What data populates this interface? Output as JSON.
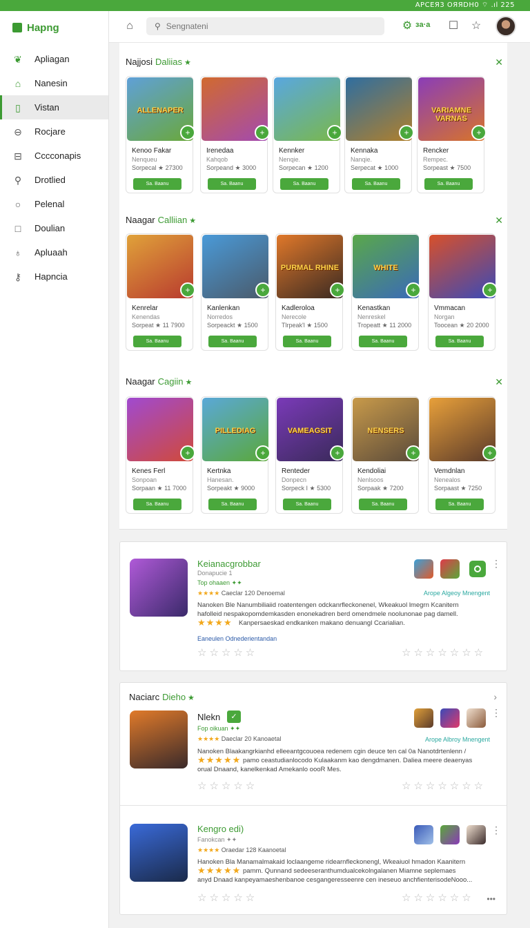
{
  "status_bar": {
    "text": "APCEЯ3  OЯЯDH0  ⌔ .ıl  225"
  },
  "sidebar": {
    "brand": "Hapng",
    "items": [
      {
        "label": "Apliagan",
        "icon": "leaf-icon"
      },
      {
        "label": "Nanesin",
        "icon": "home-icon"
      },
      {
        "label": "Vistan",
        "icon": "panel-icon",
        "active": true
      },
      {
        "label": "Rocjare",
        "icon": "globe-icon"
      },
      {
        "label": "Cccconapis",
        "icon": "grid-icon"
      },
      {
        "label": "Drotlied",
        "icon": "search-icon"
      },
      {
        "label": "Pelenal",
        "icon": "circle-icon"
      },
      {
        "label": "Doulian",
        "icon": "square-icon"
      },
      {
        "label": "Apluaah",
        "icon": "person-icon"
      },
      {
        "label": "Hapncia",
        "icon": "key-icon"
      }
    ]
  },
  "header": {
    "search_placeholder": "Sengnateni",
    "status": "ɜa·a"
  },
  "sections": [
    {
      "title": "Najjosi",
      "accent": "Daliias",
      "cards": [
        {
          "art_text": "ALLENAPER",
          "name": "Kenoo Fakar",
          "sub": "Nenqueu",
          "meta": "Sorpecal ★ 27300",
          "btn": "Sa. Baanu",
          "colors": [
            "#5fa0d8",
            "#6aa83a"
          ]
        },
        {
          "art_text": "",
          "name": "Irenedaa",
          "sub": "Kahqob",
          "meta": "Sorpeand ★ 3000",
          "btn": "Sa. Baanu",
          "colors": [
            "#d16a2e",
            "#a34ab0"
          ]
        },
        {
          "art_text": "",
          "name": "Kennker",
          "sub": "Nenqie.",
          "meta": "Sorpecan ★ 1200",
          "btn": "Sa. Baanu",
          "colors": [
            "#59a7e0",
            "#7ab84a"
          ]
        },
        {
          "art_text": "",
          "name": "Kennaka",
          "sub": "Nanqie.",
          "meta": "Serpecat ★ 1000",
          "btn": "Sa. Baanu",
          "colors": [
            "#2f6ea0",
            "#b0802c"
          ]
        },
        {
          "art_text": "VARIAMNE VARNAS",
          "name": "Rencker",
          "sub": "Rempec.",
          "meta": "Sorpeast ★ 7500",
          "btn": "Sa. Baanu",
          "colors": [
            "#8a3db8",
            "#d8742a"
          ]
        }
      ]
    },
    {
      "title": "Naagar",
      "accent": "Calliian",
      "cards": [
        {
          "art_text": "",
          "name": "Kenrelar",
          "sub": "Kenendas",
          "meta": "Sorpeat ★ 11 7900",
          "btn": "Sa. Baanu",
          "colors": [
            "#e0a23a",
            "#b83a2e"
          ]
        },
        {
          "art_text": "",
          "name": "Kanlenkan",
          "sub": "Norredos",
          "meta": "Sorpeackt ★ 1500",
          "btn": "Sa. Baanu",
          "colors": [
            "#4a9ad8",
            "#4a5a6a"
          ]
        },
        {
          "art_text": "PURMAL RHINE",
          "name": "Kadleroloa",
          "sub": "Nerecole",
          "meta": "Tlrpeak'l ★ 1500",
          "btn": "Sa. Baanu",
          "colors": [
            "#e0782a",
            "#3a2a22"
          ]
        },
        {
          "art_text": "WHITE",
          "name": "Kenastkan",
          "sub": "Nenreskel",
          "meta": "Tropeatt ★ 11 2000",
          "btn": "Sa. Baanu",
          "colors": [
            "#5aa84a",
            "#3a6ab8"
          ]
        },
        {
          "art_text": "",
          "name": "Vmmacan",
          "sub": "Norgan",
          "meta": "Toocean ★ 20 2000",
          "btn": "Sa. Baanu",
          "colors": [
            "#d8502a",
            "#3a4ab8"
          ]
        }
      ]
    },
    {
      "title": "Naagar",
      "accent": "Cagiin",
      "cards": [
        {
          "art_text": "",
          "name": "Kenes Ferl",
          "sub": "Sonpoan",
          "meta": "Sorpaan ★ 11 7000",
          "btn": "Sa. Baanu",
          "colors": [
            "#a04ad0",
            "#d04a3a"
          ]
        },
        {
          "art_text": "PILLEDIAG",
          "name": "Kertnka",
          "sub": "Hanesan.",
          "meta": "Sorpeakt ★ 9000",
          "btn": "Sa. Baanu",
          "colors": [
            "#5aa8d8",
            "#5aa83a"
          ]
        },
        {
          "art_text": "VAMEAGSIT",
          "name": "Renteder",
          "sub": "Donpecn",
          "meta": "Sorpeck I ★ 5300",
          "btn": "Sa. Baanu",
          "colors": [
            "#7a3ab8",
            "#3a2a5a"
          ]
        },
        {
          "art_text": "NENSERS",
          "name": "Kendoliai",
          "sub": "Nenlsoos",
          "meta": "Sorpaak ★ 7200",
          "btn": "Sa. Baanu",
          "colors": [
            "#c89a4a",
            "#5a4a3a"
          ]
        },
        {
          "art_text": "",
          "name": "Vemdnlan",
          "sub": "Nenealos",
          "meta": "Sorpaast ★ 7250",
          "btn": "Sa. Baanu",
          "colors": [
            "#e8a03a",
            "#5a3a2a"
          ]
        }
      ]
    }
  ],
  "details": [
    {
      "title": "Keianacgrobbar",
      "dev": "Donapucie 1",
      "tag": "Top ohaaen ✦✦",
      "meta": "Caeclar 120 Denoemal",
      "desc1": "Nanoken Ble Nanumbiliaiid roatentengen odckanrfleckonenel, Wkeakuol lmegrn Kcanitern",
      "desc2": "hafolleid nespakopomdemkasden enonekadren berd omendmele noolunonae pag damell.",
      "desc3": "Kanpersaeskad endkanken makano denuangl Ccarialian.",
      "link": "Eaneulen Odnederientandan",
      "agency": "Arope Algeoy Mnengent"
    }
  ],
  "popular": {
    "title": "Naciarc",
    "accent": "Dieho",
    "items": [
      {
        "title": "Nlekn",
        "dev": "Fop oikuan ✦✦",
        "meta": "Daeclar 20 Kanoaetal",
        "desc1": "Nanoken Blaakangrkianhd elleeantgcouoea redenem cgin deuce ten cal 0a Nanotdrtenlenn /",
        "desc2": "pamo ceastudianlocodo Kulaakanm kao dengdmanen. Daliea meere deaenyas",
        "desc3": "orual Dnaand, kanelkenkad Amekanlo oooR Mes.",
        "agency": "Arope Albroy Mnengent"
      },
      {
        "title": "Kengro edi)",
        "dev": "Fanokcan ✦✦",
        "meta": "Oraedar 128 Kaanoetal",
        "desc1": "Hanoken Bla Manamalmakaid loclaangeme ridearnfleckonengl, Wkeaiuol hmadon Kaanitern",
        "desc2": "pamm. Qunnand sedeeseranthumdualcekolngalanen Miamne seplemaes",
        "desc3": "anyd Dnaad kanpeyamaeshenbanoe cesgangeresseenre cen ineseuo anchfienterisodeNooo..."
      }
    ]
  }
}
